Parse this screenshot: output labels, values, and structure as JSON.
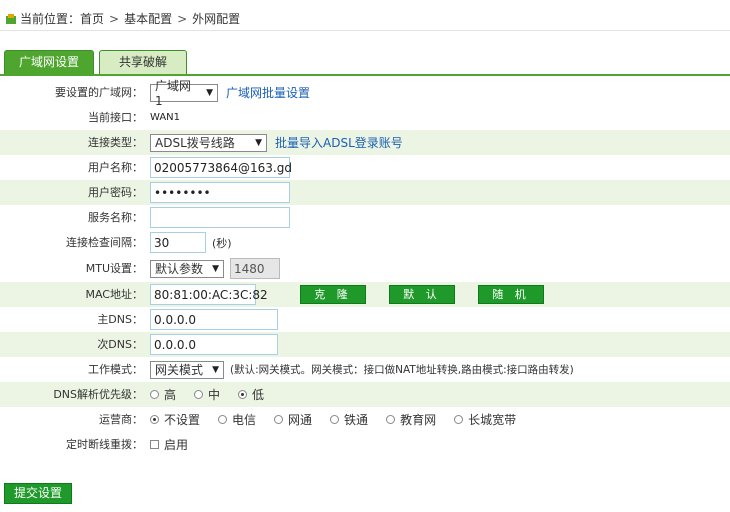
{
  "breadcrumb": {
    "prefix": "当前位置：",
    "home": "首页",
    "level1": "基本配置",
    "level2": "外网配置",
    "sep": ">"
  },
  "tabs": [
    {
      "label": "广域网设置",
      "active": true
    },
    {
      "label": "共享破解",
      "active": false
    }
  ],
  "form": {
    "wan_select": {
      "label": "要设置的广域网：",
      "value": "广域网1",
      "link": "广域网批量设置"
    },
    "interface": {
      "label": "当前接口：",
      "value": "WAN1"
    },
    "conn_type": {
      "label": "连接类型：",
      "value": "ADSL拨号线路",
      "link": "批量导入ADSL登录账号"
    },
    "username": {
      "label": "用户名称：",
      "value": "02005773864@163.gd"
    },
    "password": {
      "label": "用户密码：",
      "value": "••••••••"
    },
    "service": {
      "label": "服务名称：",
      "value": ""
    },
    "interval": {
      "label": "连接检查间隔：",
      "value": "30",
      "unit": "(秒)"
    },
    "mtu": {
      "label": "MTU设置：",
      "select": "默认参数",
      "value": "1480"
    },
    "mac": {
      "label": "MAC地址：",
      "value": "80:81:00:AC:3C:82",
      "buttons": [
        "克 隆",
        "默 认",
        "随 机"
      ]
    },
    "dns1": {
      "label": "主DNS：",
      "value": "0.0.0.0"
    },
    "dns2": {
      "label": "次DNS：",
      "value": "0.0.0.0"
    },
    "mode": {
      "label": "工作模式：",
      "value": "网关模式",
      "note": "(默认:网关模式。网关模式：接口做NAT地址转换,路由模式:接口路由转发)"
    },
    "dns_priority": {
      "label": "DNS解析优先级：",
      "options": [
        "高",
        "中",
        "低"
      ],
      "selected": 2
    },
    "isp": {
      "label": "运营商：",
      "options": [
        "不设置",
        "电信",
        "网通",
        "铁通",
        "教育网",
        "长城宽带"
      ],
      "selected": 0
    },
    "redial": {
      "label": "定时断线重拨：",
      "option": "启用"
    }
  },
  "submit_label": "提交设置",
  "colors": {
    "accent": "#4fa62f",
    "button": "#1f9a2a",
    "link": "#1a5fb4",
    "shade": "#ecf4e4"
  }
}
